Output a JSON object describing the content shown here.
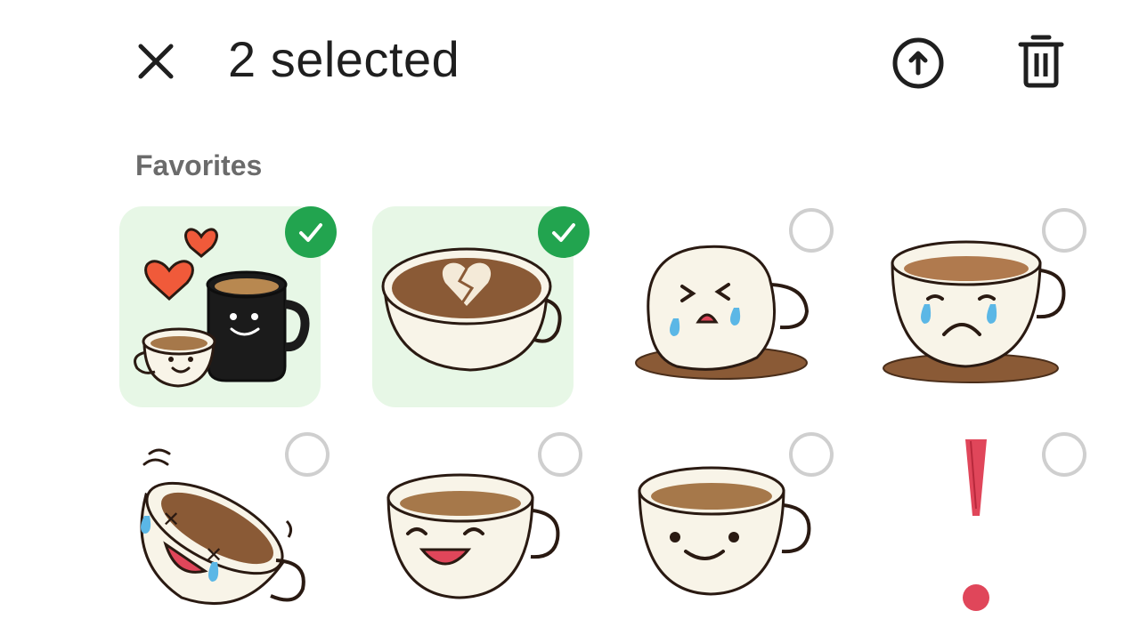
{
  "header": {
    "close_icon": "close-icon",
    "title": "2 selected",
    "share_icon": "arrow-up-circle-icon",
    "delete_icon": "trash-icon"
  },
  "section": {
    "label": "Favorites"
  },
  "colors": {
    "accent_green": "#22a44f",
    "selected_bg": "#e7f7e6",
    "ring": "#cfcfcf"
  },
  "stickers": [
    {
      "name": "hearts-coffee-pair",
      "selected": true
    },
    {
      "name": "broken-heart-latte",
      "selected": true
    },
    {
      "name": "spilled-crying-cup",
      "selected": false
    },
    {
      "name": "sad-crying-cup",
      "selected": false
    },
    {
      "name": "laughing-tears-cup",
      "selected": false
    },
    {
      "name": "happy-laughing-cup",
      "selected": false
    },
    {
      "name": "smiling-cup",
      "selected": false
    },
    {
      "name": "exclamation-mark",
      "selected": false
    }
  ]
}
